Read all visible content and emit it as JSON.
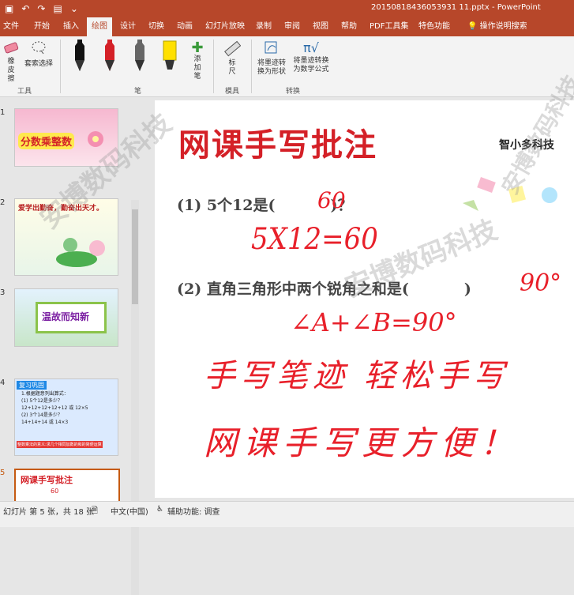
{
  "window": {
    "title": "20150818436053931 11.pptx - PowerPoint"
  },
  "menu_tabs": [
    "文件",
    "开始",
    "插入",
    "绘图",
    "设计",
    "切换",
    "动画",
    "幻灯片放映",
    "录制",
    "审阅",
    "视图",
    "帮助",
    "PDF工具集",
    "特色功能",
    "操作说明搜索"
  ],
  "active_tab": "绘图",
  "ribbon": {
    "eraser_label": "橡皮擦",
    "lasso_label": "套索选择",
    "add_pen_label": "添加笔",
    "ruler_label": "标尺",
    "ink_to_shape_label": "将墨迹转换为形状",
    "ink_to_math_label": "将墨迹转换为数学公式",
    "groups": {
      "tools": "工具",
      "pens": "笔",
      "stencils": "模具",
      "convert": "转换"
    },
    "pen_colors": [
      "#111111",
      "#d42027",
      "#666666",
      "#ffe000"
    ]
  },
  "thumbnails": [
    {
      "num": "1",
      "text": "分数乘整数"
    },
    {
      "num": "2",
      "text": "爱学出勤奋，勤奋出天才。"
    },
    {
      "num": "3",
      "text": "温故而知新"
    },
    {
      "num": "4",
      "text": "复习巩固",
      "lines": [
        "1.根据题意列出算式：",
        "(1) 5个12是多少？",
        "12+12+12+12+12 或 12×5",
        "(2) 3个14是多少？",
        "14+14+14 或 14×3"
      ],
      "footer": "整数乘法的意义:求几个相同加数的和的简便运算"
    },
    {
      "num": "5",
      "text": "网课手写批注"
    }
  ],
  "slide": {
    "title": "网课手写批注",
    "brand": "智小多科技",
    "q1": "(1)  5个12是(",
    "q1_end": ")？",
    "q2": "(2)  直角三角形中两个锐角之和是(",
    "q2_end": ")",
    "ink_answer1": "60",
    "ink_work1": "5X12=60",
    "ink_answer2": "90°",
    "ink_work2": "∠A+∠B=90°",
    "ink_line1": "手写笔迹 轻松手写",
    "ink_line2": "网课手写更方便！"
  },
  "watermark": "安博数码科技",
  "status": {
    "slide_info": "幻灯片 第 5 张，共 18 张",
    "language": "中文(中国)",
    "accessibility": "辅助功能: 调查"
  }
}
